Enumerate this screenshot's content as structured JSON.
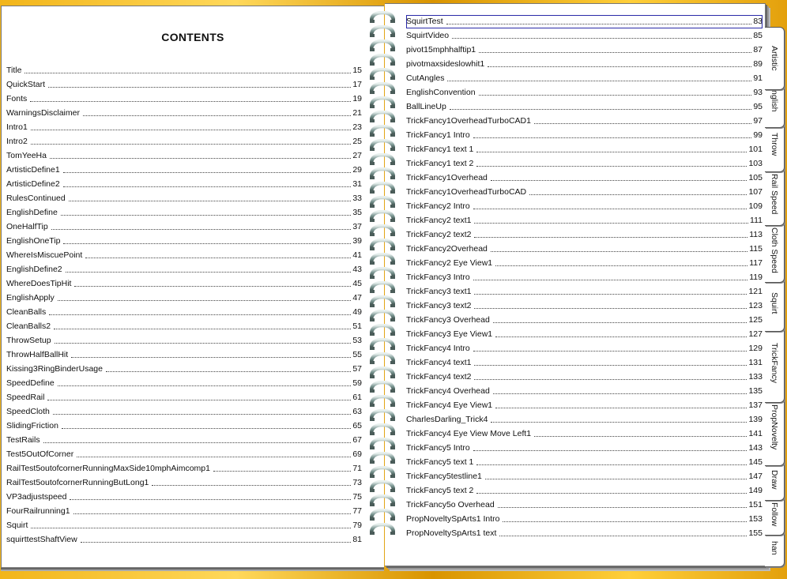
{
  "left_page": {
    "title": "CONTENTS",
    "entries": [
      {
        "title": "Title",
        "page": "15"
      },
      {
        "title": "QuickStart",
        "page": "17"
      },
      {
        "title": "Fonts",
        "page": "19"
      },
      {
        "title": "WarningsDisclaimer",
        "page": "21"
      },
      {
        "title": "Intro1",
        "page": "23"
      },
      {
        "title": "Intro2",
        "page": "25"
      },
      {
        "title": "TomYeeHa",
        "page": "27"
      },
      {
        "title": "ArtisticDefine1",
        "page": "29"
      },
      {
        "title": "ArtisticDefine2",
        "page": "31"
      },
      {
        "title": "RulesContinued",
        "page": "33"
      },
      {
        "title": "EnglishDefine",
        "page": "35"
      },
      {
        "title": "OneHalfTip",
        "page": "37"
      },
      {
        "title": "EnglishOneTip",
        "page": "39"
      },
      {
        "title": "WhereIsMiscuePoint",
        "page": "41"
      },
      {
        "title": "EnglishDefine2",
        "page": "43"
      },
      {
        "title": "WhereDoesTipHit",
        "page": "45"
      },
      {
        "title": "EnglishApply",
        "page": "47"
      },
      {
        "title": "CleanBalls",
        "page": "49"
      },
      {
        "title": "CleanBalls2",
        "page": "51"
      },
      {
        "title": "ThrowSetup",
        "page": "53"
      },
      {
        "title": "ThrowHalfBallHit",
        "page": "55"
      },
      {
        "title": "Kissing3RingBinderUsage",
        "page": "57"
      },
      {
        "title": "SpeedDefine",
        "page": "59"
      },
      {
        "title": "SpeedRail",
        "page": "61"
      },
      {
        "title": "SpeedCloth",
        "page": "63"
      },
      {
        "title": "SlidingFriction",
        "page": "65"
      },
      {
        "title": "TestRails",
        "page": "67"
      },
      {
        "title": "Test5OutOfCorner",
        "page": "69"
      },
      {
        "title": "RailTest5outofcornerRunningMaxSide10mphAimcomp1",
        "page": "71"
      },
      {
        "title": "RailTest5outofcornerRunningButLong1",
        "page": "73"
      },
      {
        "title": "VP3adjustspeed",
        "page": "75"
      },
      {
        "title": "FourRailrunning1",
        "page": "77"
      },
      {
        "title": "Squirt",
        "page": "79"
      },
      {
        "title": "squirttestShaftView",
        "page": "81"
      }
    ]
  },
  "right_page": {
    "entries": [
      {
        "title": "SquirtTest",
        "page": "83"
      },
      {
        "title": "SquirtVideo",
        "page": "85"
      },
      {
        "title": "pivot15mphhalftip1",
        "page": "87"
      },
      {
        "title": "pivotmaxsideslowhit1",
        "page": "89"
      },
      {
        "title": "CutAngles",
        "page": "91"
      },
      {
        "title": "EnglishConvention",
        "page": "93"
      },
      {
        "title": "BallLineUp",
        "page": "95"
      },
      {
        "title": "TrickFancy1OverheadTurboCAD1",
        "page": "97"
      },
      {
        "title": "TrickFancy1 Intro",
        "page": "99"
      },
      {
        "title": "TrickFancy1 text 1",
        "page": "101"
      },
      {
        "title": "TrickFancy1 text 2",
        "page": "103"
      },
      {
        "title": "TrickFancy1Overhead",
        "page": "105"
      },
      {
        "title": "TrickFancy1OverheadTurboCAD",
        "page": "107"
      },
      {
        "title": "TrickFancy2 Intro",
        "page": "109"
      },
      {
        "title": "TrickFancy2 text1",
        "page": "111"
      },
      {
        "title": "TrickFancy2 text2",
        "page": "113"
      },
      {
        "title": "TrickFancy2Overhead",
        "page": "115"
      },
      {
        "title": "TrickFancy2 Eye View1",
        "page": "117"
      },
      {
        "title": "TrickFancy3 Intro",
        "page": "119"
      },
      {
        "title": "TrickFancy3 text1",
        "page": "121"
      },
      {
        "title": "TrickFancy3 text2",
        "page": "123"
      },
      {
        "title": "TrickFancy3 Overhead",
        "page": "125"
      },
      {
        "title": "TrickFancy3 Eye View1",
        "page": "127"
      },
      {
        "title": "TrickFancy4 Intro",
        "page": "129"
      },
      {
        "title": "TrickFancy4 text1",
        "page": "131"
      },
      {
        "title": "TrickFancy4 text2",
        "page": "133"
      },
      {
        "title": "TrickFancy4 Overhead",
        "page": "135"
      },
      {
        "title": "TrickFancy4 Eye View1",
        "page": "137"
      },
      {
        "title": "CharlesDarling_Trick4",
        "page": "139"
      },
      {
        "title": "TrickFancy4 Eye View Move Left1",
        "page": "141"
      },
      {
        "title": "TrickFancy5 Intro",
        "page": "143"
      },
      {
        "title": "TrickFancy5 text 1",
        "page": "145"
      },
      {
        "title": "TrickFancy5testline1",
        "page": "147"
      },
      {
        "title": "TrickFancy5 text 2",
        "page": "149"
      },
      {
        "title": "TrickFancy5o Overhead",
        "page": "151"
      },
      {
        "title": "PropNoveltySpArts1 Intro",
        "page": "153"
      },
      {
        "title": "PropNoveltySpArts1 text",
        "page": "155"
      }
    ]
  },
  "tabs": [
    {
      "label": "Artistic"
    },
    {
      "label": "English"
    },
    {
      "label": "Throw"
    },
    {
      "label": "Rail Speed"
    },
    {
      "label": "Cloth Speed"
    },
    {
      "label": "Squirt"
    },
    {
      "label": "TrickFancy"
    },
    {
      "label": "PropNovelty"
    },
    {
      "label": "Draw"
    },
    {
      "label": "Follow"
    },
    {
      "label": "han"
    }
  ],
  "colors": {
    "background": "#f2b51a",
    "page": "#ffffff",
    "selection_border": "#2a2aa8"
  }
}
